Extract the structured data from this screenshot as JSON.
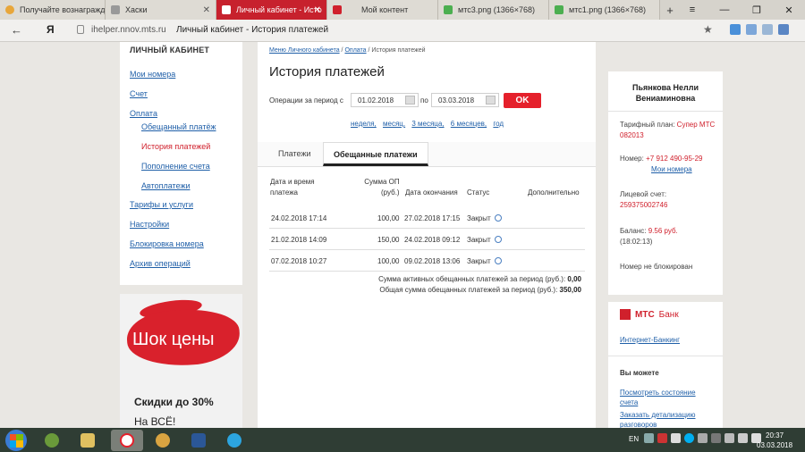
{
  "browser": {
    "tabs": [
      {
        "label": "Получайте вознагражде",
        "color": "#e8a63a",
        "active": false
      },
      {
        "label": "Хаски",
        "color": "#888888",
        "active": false
      },
      {
        "label": "Личный кабинет - Исто",
        "color": "#ffffff",
        "active": true
      },
      {
        "label": "Мой контент",
        "color": "#d0202c",
        "active": false
      },
      {
        "label": "мтс3.png (1366×768)",
        "color": "#4caf50",
        "active": false
      },
      {
        "label": "мтс1.png (1366×768)",
        "color": "#4caf50",
        "active": false
      }
    ],
    "new_tab": "+",
    "window_controls": {
      "menu": "≡",
      "minimize": "—",
      "restore": "❐",
      "close": "✕"
    },
    "back": "←",
    "yandex": "Я",
    "url": "ihelper.nnov.mts.ru",
    "page_title": "Личный кабинет - История платежей",
    "bookmark": "★"
  },
  "leftnav": {
    "heading": "ЛИЧНЫЙ КАБИНЕТ",
    "items": [
      {
        "label": "Мои номера",
        "sub": false,
        "current": false
      },
      {
        "label": "Счет",
        "sub": false,
        "current": false
      },
      {
        "label": "Оплата",
        "sub": false,
        "current": false
      },
      {
        "label": "Обещанный платёж",
        "sub": true,
        "current": false
      },
      {
        "label": "История платежей",
        "sub": true,
        "current": true
      },
      {
        "label": "Пополнение счета",
        "sub": true,
        "current": false
      },
      {
        "label": "Автоплатежи",
        "sub": true,
        "current": false
      },
      {
        "label": "Тарифы и услуги",
        "sub": false,
        "current": false
      },
      {
        "label": "Настройки",
        "sub": false,
        "current": false
      },
      {
        "label": "Блокировка номера",
        "sub": false,
        "current": false
      },
      {
        "label": "Архив операций",
        "sub": false,
        "current": false
      }
    ]
  },
  "promo": {
    "headline": "Шок цены",
    "line1": "Скидки до 30%",
    "line2": "На ВСЁ!"
  },
  "main": {
    "breadcrumb": {
      "link1": "Меню Личного кабинета",
      "sep": "/",
      "link2": "Оплата",
      "current": "История платежей"
    },
    "title": "История платежей",
    "period_label": "Операции за период с",
    "date_from": "01.02.2018",
    "po": "по",
    "date_to": "03.03.2018",
    "ok": "OK",
    "quick": [
      "неделя,",
      "месяц,",
      "3 месяца,",
      "6 месяцев,",
      "год"
    ],
    "tabs": [
      "Платежи",
      "Обещанные платежи"
    ],
    "headers": {
      "date": [
        "Дата и время",
        "платежа"
      ],
      "sum": [
        "Сумма ОП",
        "(руб.)"
      ],
      "end": "Дата окончания",
      "status": "Статус",
      "extra": "Дополнительно"
    },
    "rows": [
      {
        "date": "24.02.2018 17:14",
        "sum": "100,00",
        "end": "27.02.2018 17:15",
        "status": "Закрыт"
      },
      {
        "date": "21.02.2018 14:09",
        "sum": "150,00",
        "end": "24.02.2018 09:12",
        "status": "Закрыт"
      },
      {
        "date": "07.02.2018 10:27",
        "sum": "100,00",
        "end": "09.02.2018 13:06",
        "status": "Закрыт"
      }
    ],
    "total_active_label": "Сумма активных обещанных платежей за период (руб.):",
    "total_active": "0,00",
    "total_all_label": "Общая сумма обещанных платежей за период (руб.):",
    "total_all": "350,00"
  },
  "account": {
    "name_line1": "Пьянкова Нелли",
    "name_line2": "Вениаминовна",
    "tariff_label": "Тарифный план:",
    "tariff_value": "Супер МТС 082013",
    "number_label": "Номер:",
    "number_value": "+7 912 490-95-29",
    "my_numbers": "Мои номера",
    "account_label": "Лицевой счет:",
    "account_value": "259375002746",
    "balance_label": "Баланс:",
    "balance_value": "9.56 руб.",
    "balance_time": "(18:02:13)",
    "status": "Номер не блокирован"
  },
  "bank": {
    "brand": "МТС",
    "brand_suffix": "Банк",
    "internet_banking": "Интернет-Банкинг",
    "can_label": "Вы можете",
    "link1": "Посмотреть состояние счета",
    "link2": "Заказать детализацию разговоров"
  },
  "taskbar": {
    "lang": "EN",
    "time": "20:37",
    "date": "03.03.2018"
  }
}
